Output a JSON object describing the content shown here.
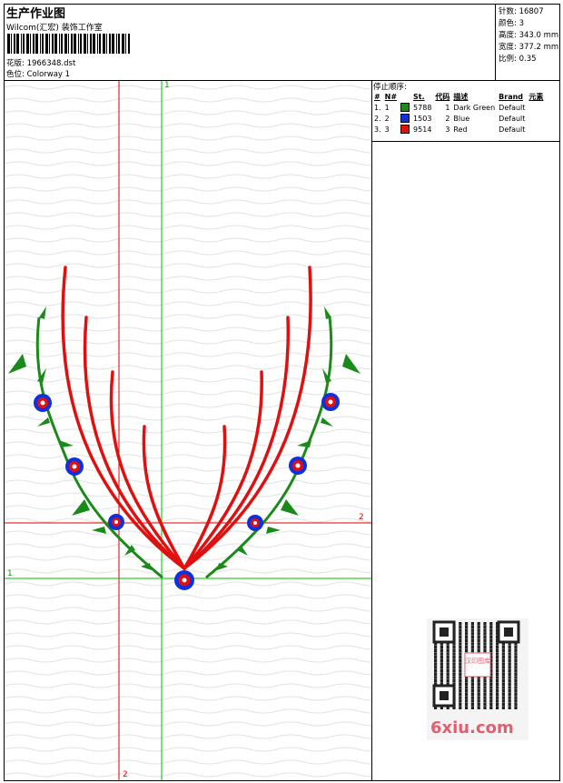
{
  "header": {
    "title": "生产作业图",
    "subtitle": "Wilcom(汇宏) 装饰工作室",
    "design_label": "花版:",
    "design_file": "1966348.dst",
    "colorway_label": "色位:",
    "colorway": "Colorway 1"
  },
  "stats": [
    {
      "label": "针数:",
      "value": "16807"
    },
    {
      "label": "颜色:",
      "value": "3"
    },
    {
      "label": "高度:",
      "value": "343.0 mm"
    },
    {
      "label": "宽度:",
      "value": "377.2 mm"
    },
    {
      "label": "比例:",
      "value": "0.35"
    }
  ],
  "stop_sequence": {
    "title": "停止顺序:",
    "columns": [
      "#",
      "N#",
      "St.",
      "代码",
      "描述",
      "Brand",
      "元素"
    ],
    "rows": [
      {
        "num": "1.",
        "n": "1",
        "color": "#1a8a1a",
        "st": "5788",
        "code": "1",
        "desc": "Dark Green",
        "brand": "Default"
      },
      {
        "num": "2.",
        "n": "2",
        "color": "#1030e0",
        "st": "1503",
        "code": "2",
        "desc": "Blue",
        "brand": "Default"
      },
      {
        "num": "3.",
        "n": "3",
        "color": "#e01010",
        "st": "9514",
        "code": "3",
        "desc": "Red",
        "brand": "Default"
      }
    ]
  },
  "axes": {
    "v1": "1",
    "v2": "2",
    "h1": "1",
    "h2": "2"
  },
  "watermark": "6xiu.com",
  "qr_text": "汉印图库",
  "colors": {
    "green": "#1a8a1a",
    "blue": "#1030e0",
    "red": "#e01010",
    "axis_red": "#e00000",
    "axis_green": "#00c000"
  }
}
